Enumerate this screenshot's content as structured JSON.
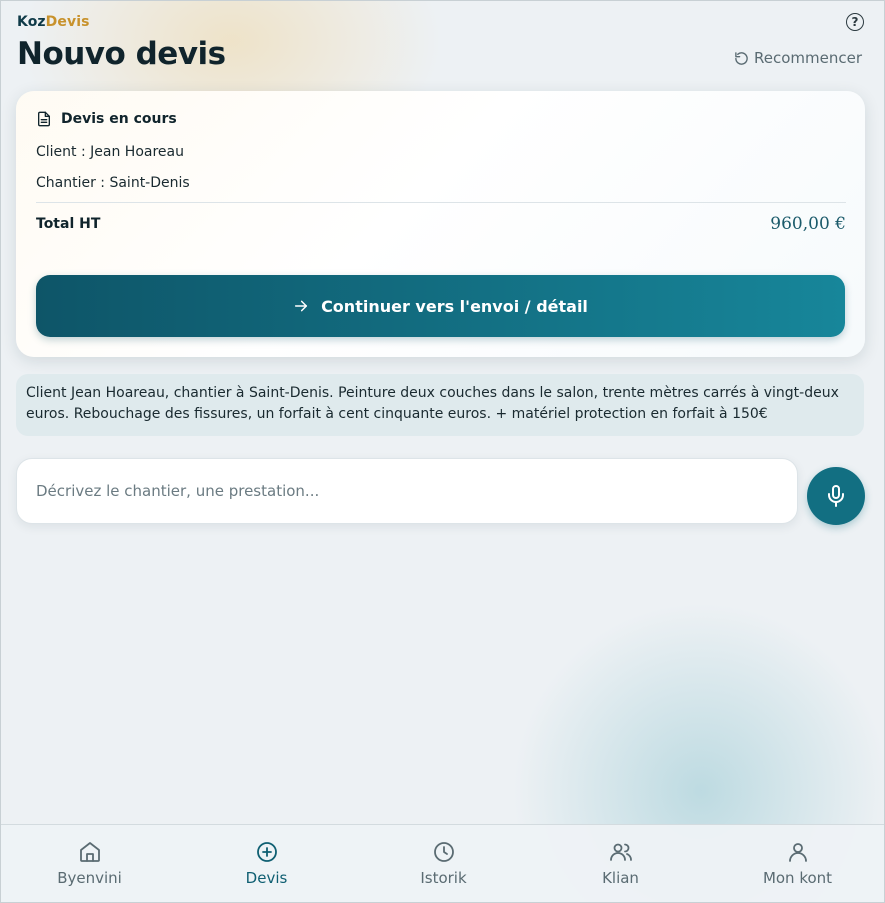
{
  "brand": {
    "part1": "Koz",
    "part2": "Devis"
  },
  "header": {
    "title": "Nouvo devis",
    "restart_label": "Recommencer",
    "help_glyph": "?"
  },
  "summary": {
    "heading": "Devis en cours",
    "client": "Client : Jean Hoareau",
    "chantier": "Chantier : Saint-Denis",
    "total_label": "Total HT",
    "total_value": "960,00 €",
    "continue_label": "Continuer vers l'envoi / détail"
  },
  "transcript": {
    "text": "Client Jean Hoareau, chantier à Saint-Denis. Peinture deux couches dans le salon, trente mètres carrés à vingt-deux euros. Rebouchage des fissures, un forfait à cent cinquante euros. + matériel protection en forfait à 150€"
  },
  "composer": {
    "placeholder": "Décrivez le chantier, une prestation...",
    "value": ""
  },
  "nav": {
    "items": [
      {
        "label": "Byenvini",
        "icon": "home-icon"
      },
      {
        "label": "Devis",
        "icon": "plus-circle-icon",
        "active": true
      },
      {
        "label": "Istorik",
        "icon": "clock-icon"
      },
      {
        "label": "Klian",
        "icon": "users-icon"
      },
      {
        "label": "Mon kont",
        "icon": "user-icon"
      }
    ]
  },
  "colors": {
    "primary": "#126f82",
    "brand_accent": "#c8922c",
    "nav_active": "#0f5f72",
    "nav_inactive": "#5a6b72"
  }
}
